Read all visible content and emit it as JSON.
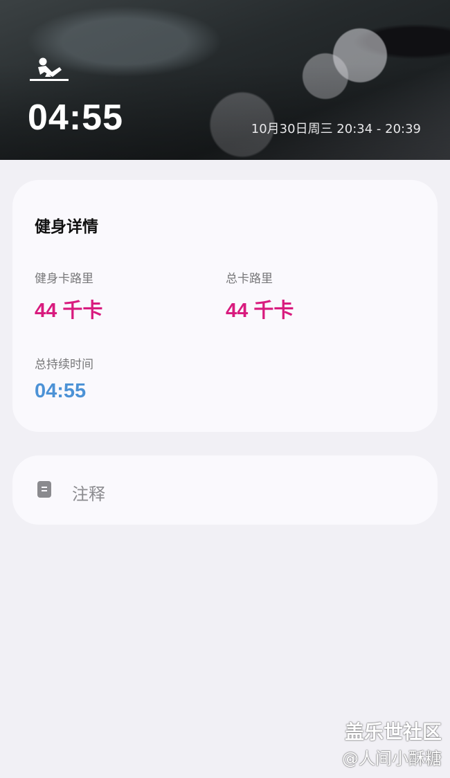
{
  "hero": {
    "icon": "situp-exercise-icon",
    "duration": "04:55",
    "date_range": "10月30日周三 20:34 - 20:39"
  },
  "details": {
    "title": "健身详情",
    "stats": [
      {
        "label": "健身卡路里",
        "value": "44 千卡",
        "color": "#d81b7e"
      },
      {
        "label": "总卡路里",
        "value": "44 千卡",
        "color": "#d81b7e"
      },
      {
        "label": "总持续时间",
        "value": "04:55",
        "color": "#4c92d6"
      }
    ]
  },
  "notes": {
    "icon": "note-icon",
    "label": "注释"
  },
  "watermark": {
    "title": "盖乐世社区",
    "subtitle": "@人间小酥糖"
  }
}
